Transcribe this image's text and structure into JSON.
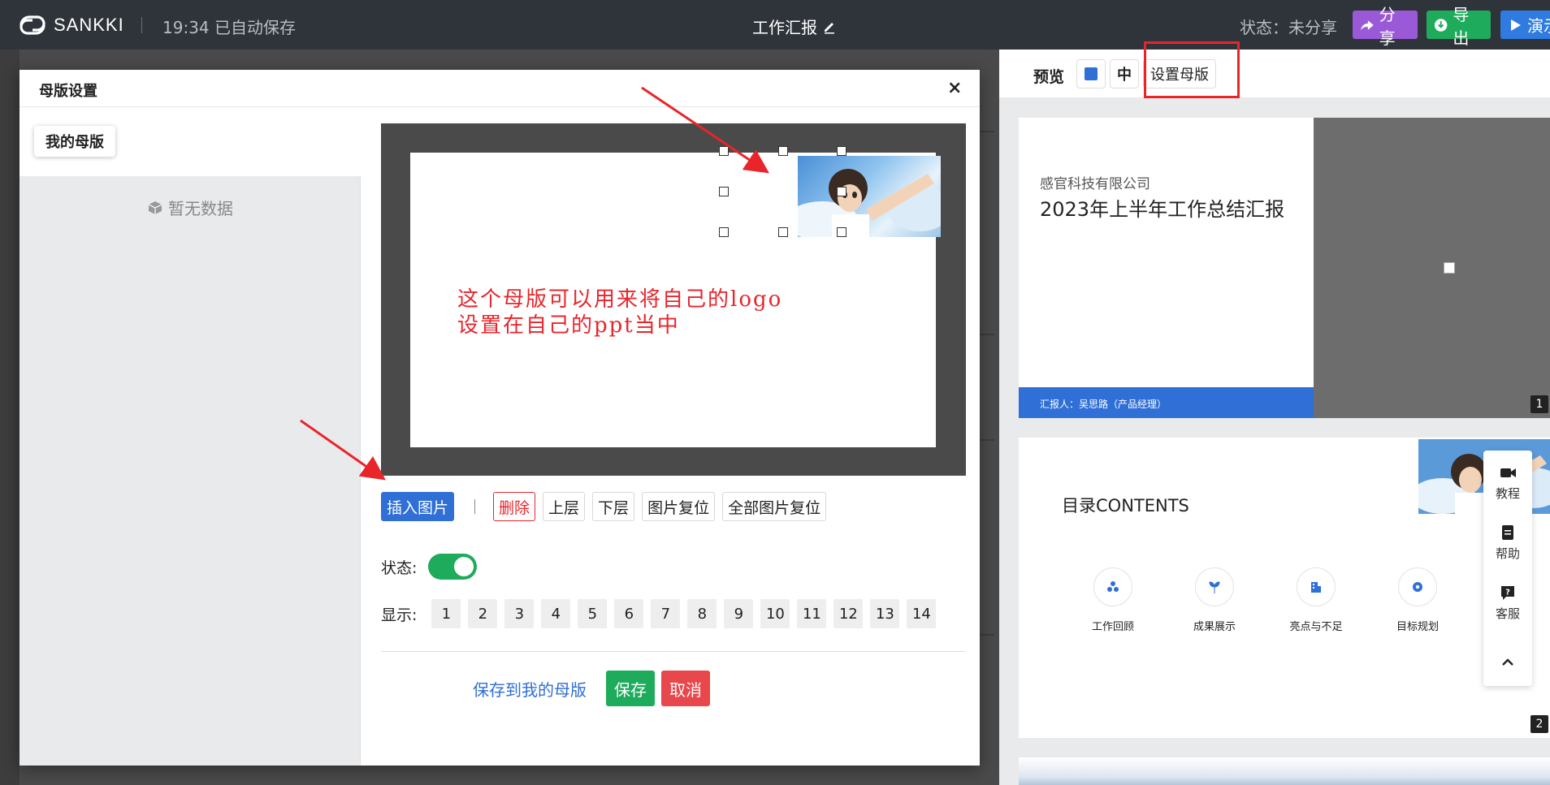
{
  "topbar": {
    "brand": "SANKKI",
    "autosave": "19:34 已自动保存",
    "doc_title": "工作汇报",
    "status": "状态：未分享",
    "share": "分享",
    "export": "导出",
    "present": "演示"
  },
  "preview": {
    "label": "预览",
    "mid_btn": "中",
    "set_master": "设置母版",
    "slide1": {
      "company": "感官科技有限公司",
      "title": "2023年上半年工作总结汇报",
      "reporter": "汇报人：吴思路（产品经理）",
      "num": "1"
    },
    "slide2": {
      "title": "目录CONTENTS",
      "items": [
        "工作回顾",
        "成果展示",
        "亮点与不足",
        "目标规划"
      ],
      "num": "2"
    }
  },
  "side_help": {
    "tutorial": "教程",
    "help": "帮助",
    "service": "客服"
  },
  "modal": {
    "title": "母版设置",
    "close": "×",
    "tab_mine": "我的母版",
    "empty": "暂无数据",
    "note": "这个母版可以用来将自己的logo\n设置在自己的ppt当中",
    "toolbar": {
      "insert": "插入图片",
      "delete": "删除",
      "up": "上层",
      "down": "下层",
      "reset": "图片复位",
      "reset_all": "全部图片复位"
    },
    "status_label": "状态:",
    "status_on": true,
    "display_label": "显示:",
    "pages": [
      "1",
      "2",
      "3",
      "4",
      "5",
      "6",
      "7",
      "8",
      "9",
      "10",
      "11",
      "12",
      "13",
      "14"
    ],
    "save_mine": "保存到我的母版",
    "save": "保存",
    "cancel": "取消"
  },
  "colors": {
    "primary": "#2f6fd6",
    "green": "#1eab5b",
    "red": "#e8474b",
    "annotation": "#e8252b",
    "share": "#9a5ad8"
  }
}
